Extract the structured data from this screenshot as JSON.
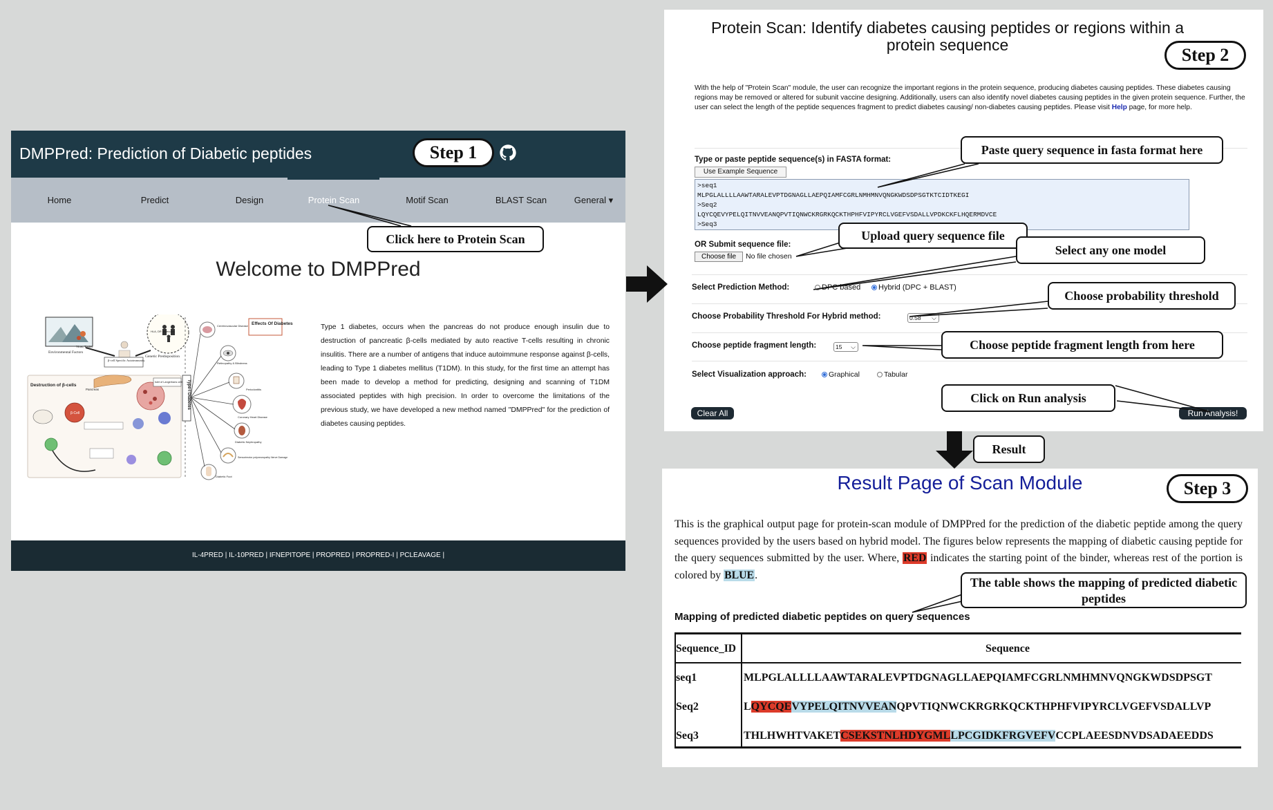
{
  "step1": {
    "app_title": "DMPPred: Prediction of Diabetic peptides",
    "step_label": "Step 1",
    "social_icons": [
      "facebook-icon",
      "twitter-icon",
      "github-icon"
    ],
    "nav": [
      "Home",
      "Predict",
      "Design",
      "Protein Scan",
      "Motif Scan",
      "BLAST Scan",
      "General ▾"
    ],
    "active_nav": "Protein Scan",
    "callout": "Click here to Protein Scan",
    "welcome": "Welcome to DMPPred",
    "description": "Type 1 diabetes, occurs when the pancreas do not produce enough insulin due to destruction of pancreatic β-cells mediated by auto reactive T-cells resulting in chronic insulitis. There are a number of antigens that induce autoimmune response against β-cells, leading to Type 1 diabetes mellitus (T1DM). In this study, for the first time an attempt has been made to develop a method for predicting, designing and scanning of T1DM associated peptides with high precision. In order to overcome the limitations of the previous study, we have developed a new method named \"DMPPred\" for the prediction of diabetes causing peptides.",
    "diagram": {
      "environmental": "Environmental Factors",
      "virus": "Virus, Toxins",
      "genetic": "Genetic Predisposition",
      "hla": "HLA, DR Molecules",
      "bcell_auto": "β-cell Specific Autoimmunity",
      "destruction": "Destruction of β-cells",
      "pancreas": "Pancreas",
      "islet": "Islet of Langerhans cells",
      "effects": "Effects Of Diabetes",
      "type1": "Type-I Diabetes",
      "complications": [
        "Cerebrovascular Disease",
        "Retinopathy & Blindness",
        "Periodontitis",
        "Coronary Heart Disease",
        "Diabetic Nephropathy",
        "Sensorimotor polyneuropathy Nerve Damage",
        "Diabetic Foot"
      ]
    },
    "footer_links": "IL-4PRED | IL-10PRED | IFNEPITOPE | PROPRED | PROPRED-I | PCLEAVAGE |"
  },
  "step2": {
    "title": "Protein Scan: Identify diabetes causing peptides or regions within a protein sequence",
    "step_label": "Step 2",
    "intro_before_help": "With the help of \"Protein Scan\" module, the user can recognize the important regions in the protein sequence, producing diabetes causing peptides. These diabetes causing regions may be removed or altered for subunit vaccine designing. Additionally, users can also identify novel diabetes causing peptides in the given protein sequence. Further, the user can select the length of the peptide sequences fragment to predict diabetes causing/ non-diabetes causing peptides. Please visit ",
    "help_link": "Help",
    "intro_after_help": " page, for more help.",
    "input_label": "Type or paste peptide sequence(s) in FASTA format:",
    "example_button": "Use Example Sequence",
    "sequence_lines": [
      ">seq1",
      "MLPGLALLLLAAWTARALEVPTDGNAGLLAEPQIAMFCGRLNMHMNVQNGKWDSDPSGTKTCIDTKEGI",
      ">Seq2",
      "LQYCQEVYPELQITNVVEANQPVTIQNWCKRGRKQCKTHPHFVIPYRCLVGEFVSDALLVPDKCKFLHQERMDVCE",
      ">Seq3"
    ],
    "upload_label": "OR  Submit sequence file:",
    "choose_file": "Choose file",
    "no_file": "No file chosen",
    "method_label": "Select Prediction Method:",
    "method_options": [
      "DPC based",
      "Hybrid (DPC + BLAST)"
    ],
    "method_selected": "Hybrid (DPC + BLAST)",
    "threshold_label": "Choose Probability Threshold For Hybrid method:",
    "threshold_value": "0.58",
    "length_label": "Choose peptide fragment length:",
    "length_value": "15",
    "viz_label": "Select Visualization approach:",
    "viz_options": [
      "Graphical",
      "Tabular"
    ],
    "viz_selected": "Graphical",
    "clear_button": "Clear All",
    "run_button": "Run Analysis!",
    "callouts": {
      "paste": "Paste query sequence in fasta format here",
      "upload": "Upload query sequence file",
      "model": "Select any one model",
      "threshold": "Choose probability threshold",
      "length": "Choose peptide fragment length from here",
      "run": "Click on Run analysis"
    }
  },
  "result_label": "Result",
  "step3": {
    "title": "Result Page of Scan Module",
    "step_label": "Step 3",
    "desc_part1": "This is the graphical output page for protein-scan module of DMPPred for the prediction of the diabetic peptide among the query sequences provided by the users based on hybrid model. The figures below represents the mapping of diabetic causing peptide for the query sequences submitted by the user. Where, ",
    "red_word": "RED",
    "desc_part2": " indicates the starting point of the binder, whereas rest of the portion is colored by ",
    "blue_word": "BLUE",
    "desc_part3": ".",
    "table_heading": "Mapping of predicted diabetic peptides on query sequences",
    "table_callout": "The table shows the mapping of predicted diabetic peptides",
    "columns": [
      "Sequence_ID",
      "Sequence"
    ],
    "rows": [
      {
        "id": "seq1",
        "pre": "MLPGLALLLLAAWTARALEVPTDGNAGLLAEPQIAMFCGRLNMHMNVQNGKWDSDPSGT",
        "red": "",
        "blue": "",
        "post": ""
      },
      {
        "id": "Seq2",
        "pre": "L",
        "red": "QYCQE",
        "blue": "VYPELQITNVVEAN",
        "post": "QPVTIQNWCKRGRKQCKTHPHFVIPYRCLVGEFVSDALLVP"
      },
      {
        "id": "Seq3",
        "pre": "THLHWHTVAKET",
        "red": "CSEKSTNLHDYGML",
        "blue": "LPCGIDKFRGVEFV",
        "post": "CCPLAEESDNVDSADAEEDDS"
      }
    ],
    "colors": {
      "red": "#dd3b2a",
      "blue": "#b9dbe9",
      "title": "#141e99"
    }
  }
}
